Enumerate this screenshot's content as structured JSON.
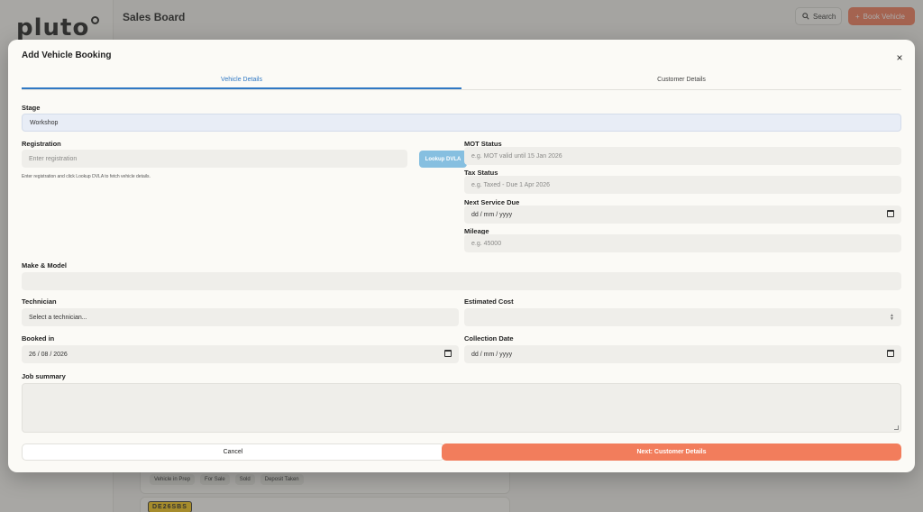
{
  "background": {
    "logo": "pluto",
    "page_title": "Sales Board",
    "search_label": "Search",
    "book_vehicle_label": "Book Vehicle",
    "chips": [
      "Vehicle in Prep",
      "For Sale",
      "Sold",
      "Deposit Taken"
    ],
    "plate": "DE26SBS"
  },
  "modal": {
    "title": "Add Vehicle Booking",
    "close_icon": "×",
    "tabs": [
      {
        "label": "Vehicle Details",
        "active": true
      },
      {
        "label": "Customer Details",
        "active": false
      }
    ],
    "stage": {
      "label": "Stage",
      "value": "Workshop"
    },
    "registration": {
      "label": "Registration",
      "placeholder": "Enter registration",
      "hint": "Enter registration and click Lookup DVLA to fetch vehicle details."
    },
    "lookup_button": "Lookup DVLA",
    "mot_status": {
      "label": "MOT Status",
      "placeholder": "e.g. MOT valid until 15 Jan 2026"
    },
    "tax_status": {
      "label": "Tax Status",
      "placeholder": "e.g. Taxed - Due 1 Apr 2026"
    },
    "next_service": {
      "label": "Next Service Due",
      "value": "dd / mm / yyyy"
    },
    "mileage": {
      "label": "Mileage",
      "placeholder": "e.g. 45000"
    },
    "make_model": {
      "label": "Make & Model",
      "value": ""
    },
    "technician": {
      "label": "Technician",
      "value": "Select a technician..."
    },
    "estimated_cost": {
      "label": "Estimated Cost",
      "value": ""
    },
    "booked_in": {
      "label": "Booked in",
      "value": "26 / 08 / 2026"
    },
    "collection_date": {
      "label": "Collection Date",
      "value": "dd / mm / yyyy"
    },
    "job_summary": {
      "label": "Job summary",
      "value": ""
    },
    "cancel_button": "Cancel",
    "next_button": "Next: Customer Details"
  },
  "colors": {
    "accent_blue": "#2f78c4",
    "primary_orange": "#f27d5c",
    "lookup_blue": "#86bfe0"
  }
}
